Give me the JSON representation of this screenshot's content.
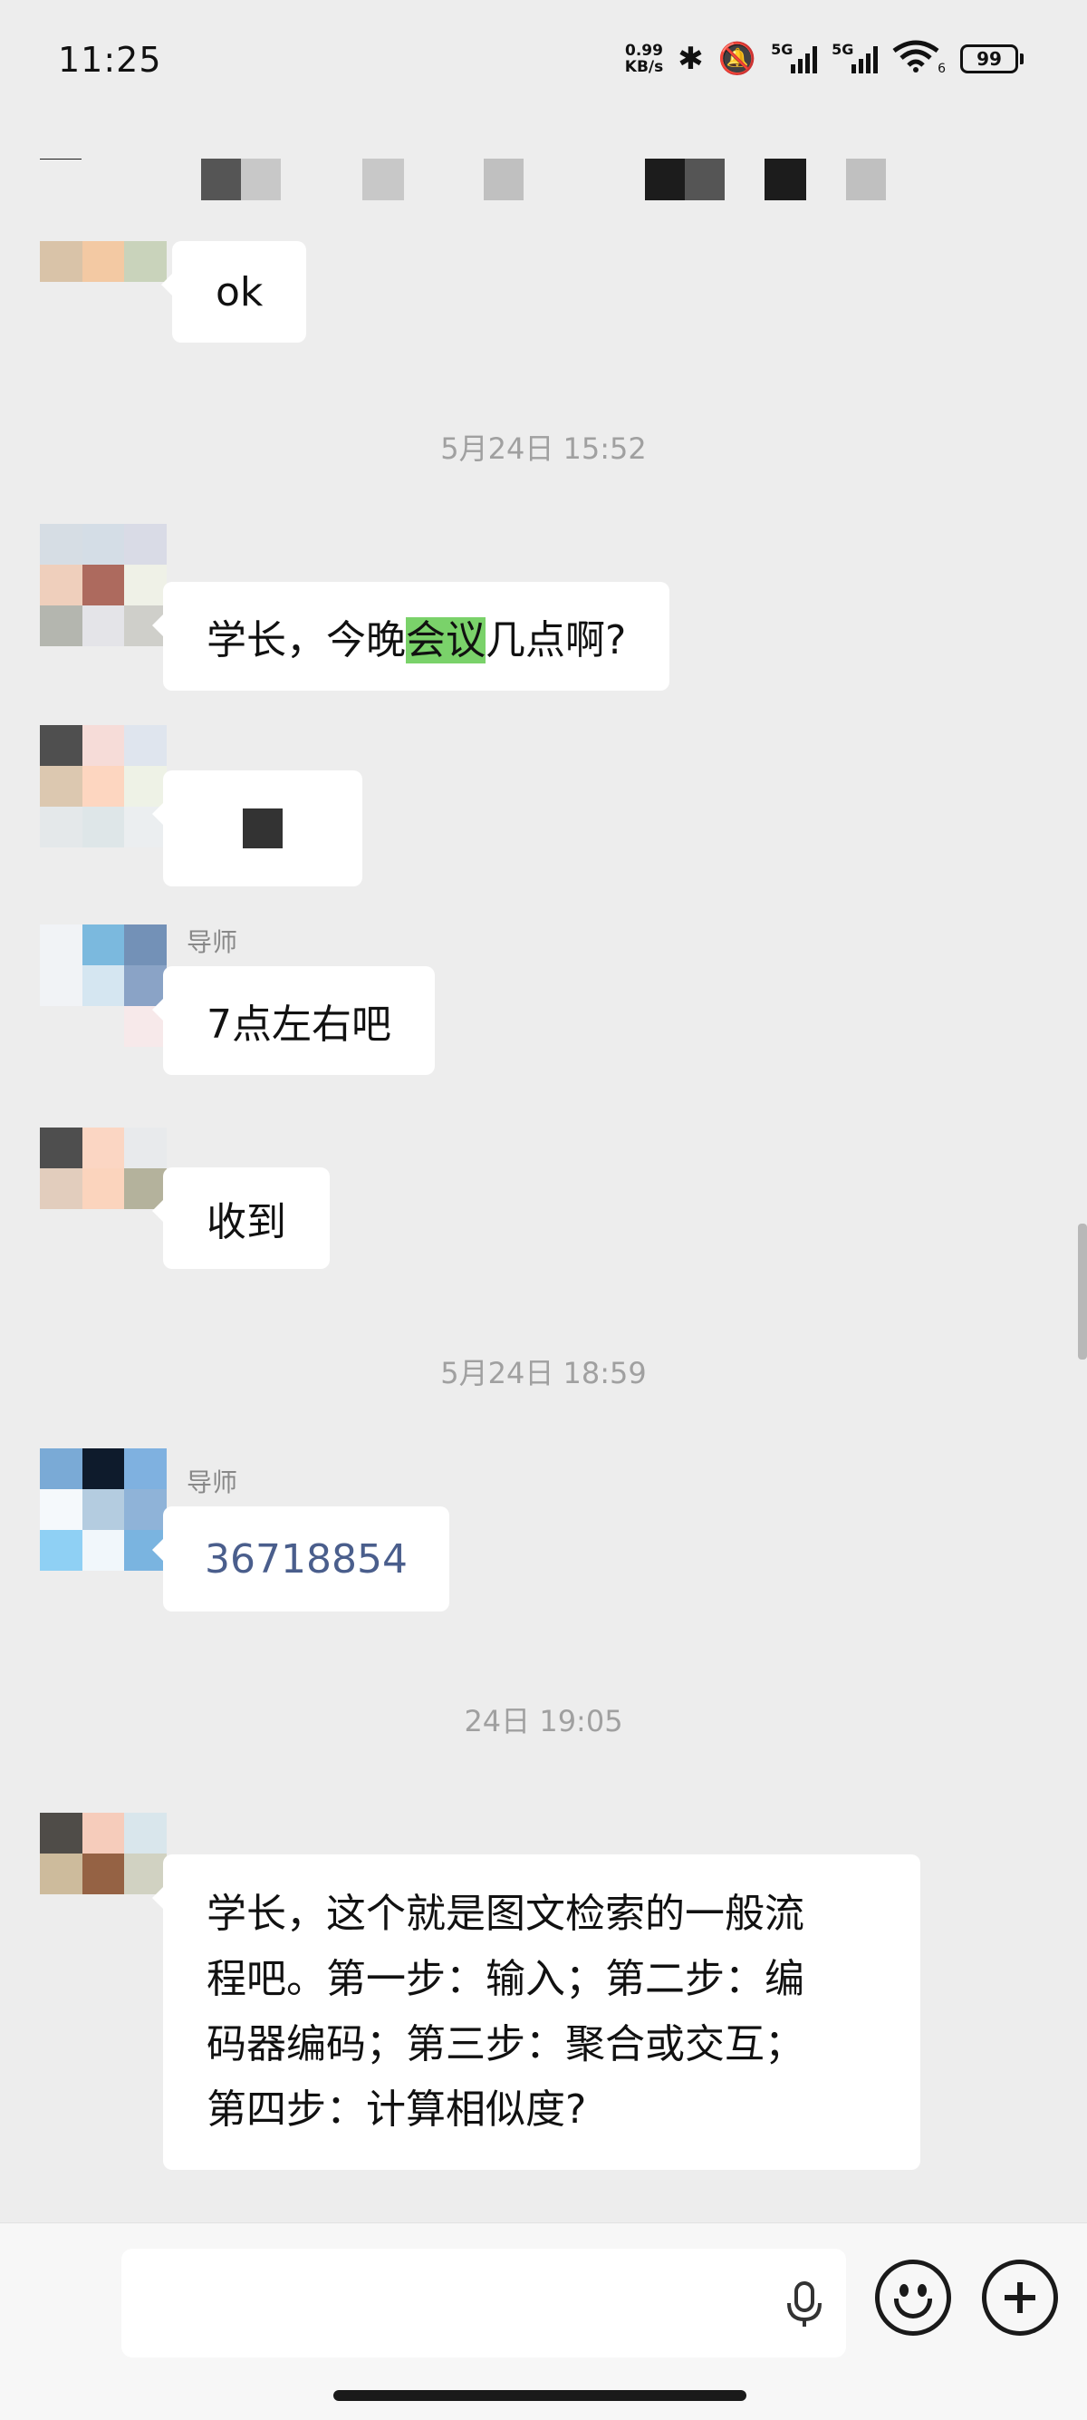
{
  "status_bar": {
    "time": "11:25",
    "net_speed_value": "0.99",
    "net_speed_unit": "KB/s",
    "sim1_label": "5G",
    "sim2_label": "5G",
    "wifi_label": "6",
    "battery": "99"
  },
  "messages": [
    {
      "type": "text",
      "text": "ok"
    },
    {
      "type": "timestamp",
      "text": "5月24日 15:52"
    },
    {
      "type": "text",
      "text_before": "学长，今晚",
      "highlight": "会议",
      "text_after": "几点啊?"
    },
    {
      "type": "censored"
    },
    {
      "type": "text",
      "sender": "导师",
      "text": "7点左右吧"
    },
    {
      "type": "text",
      "text": "收到"
    },
    {
      "type": "timestamp",
      "text": "5月24日 18:59"
    },
    {
      "type": "number",
      "sender": "导师",
      "text": "36718854"
    },
    {
      "type": "timestamp",
      "text": "24日 19:05"
    },
    {
      "type": "text",
      "lines": [
        "学长，这个就是图文检索的一般流",
        "程吧。第一步：输入；第二步：编",
        "码器编码；第三步：聚合或交互；",
        "第四步：计算相似度?"
      ]
    }
  ],
  "input": {
    "placeholder": ""
  },
  "colors": {
    "background": "#ededed",
    "bubble": "#ffffff",
    "highlight": "#7ad26a",
    "timestamp": "#a0a0a0",
    "link": "#4a5e8c"
  }
}
